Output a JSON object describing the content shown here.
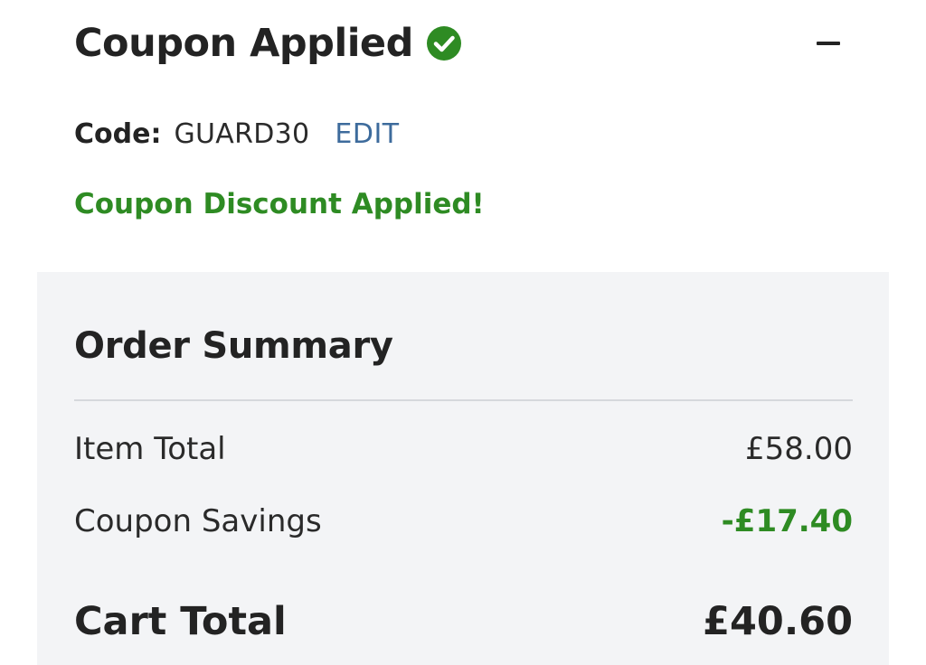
{
  "coupon": {
    "title": "Coupon Applied",
    "status_icon": "check-circle-icon",
    "collapse_icon": "minus-icon",
    "code_label": "Code:",
    "code_value": "GUARD30",
    "edit_label": "EDIT",
    "success_message": "Coupon Discount Applied!"
  },
  "summary": {
    "title": "Order Summary",
    "rows": [
      {
        "label": "Item Total",
        "value": "£58.00"
      },
      {
        "label": "Coupon Savings",
        "value": "-£17.40"
      }
    ],
    "total_label": "Cart Total",
    "total_value": "£40.60"
  },
  "colors": {
    "success_green": "#2e8b23",
    "link_blue": "#3d6b9c",
    "summary_bg": "#f3f4f6",
    "text_dark": "#232323"
  }
}
